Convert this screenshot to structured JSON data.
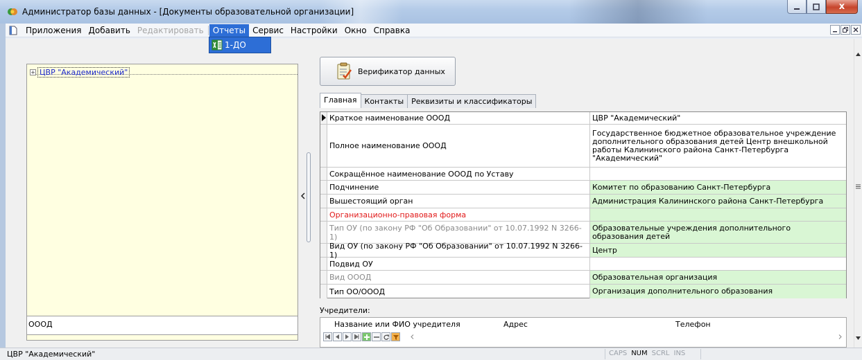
{
  "window": {
    "title": "Администратор базы данных - [Документы образовательной организации]",
    "close_glyph": "x"
  },
  "menu": {
    "items": [
      {
        "label": "Приложения",
        "state": "normal"
      },
      {
        "label": "Добавить",
        "state": "normal"
      },
      {
        "label": "Редактировать",
        "state": "disabled"
      },
      {
        "label": "Отчеты",
        "state": "active"
      },
      {
        "label": "Сервис",
        "state": "normal"
      },
      {
        "label": "Настройки",
        "state": "normal"
      },
      {
        "label": "Окно",
        "state": "normal"
      },
      {
        "label": "Справка",
        "state": "normal"
      }
    ],
    "dropdown_item": "1-ДО"
  },
  "tree": {
    "expander": "+",
    "root_label": "ЦВР \"Академический\"",
    "footer": "ОООД"
  },
  "toolbar": {
    "verify_label": "Верификатор данных"
  },
  "tabs": [
    "Главная",
    "Контакты",
    "Реквизиты и классификаторы"
  ],
  "grid": {
    "rows": [
      {
        "name": "Краткое наименование ОООД",
        "value": "ЦВР \"Академический\"",
        "style": "normal",
        "green": false,
        "current": true
      },
      {
        "name": "Полное наименование ОООД",
        "value": "Государственное бюджетное образовательное учреждение дополнительного образования детей Центр внешкольной работы Калининского района Санкт-Петербурга \"Академический\"",
        "style": "normal",
        "green": false,
        "current": false
      },
      {
        "name": "Сокращённое наименование ОООД по Уставу",
        "value": "",
        "style": "normal",
        "green": false,
        "current": false
      },
      {
        "name": "Подчинение",
        "value": "Комитет по образованию Санкт-Петербурга",
        "style": "normal",
        "green": true,
        "current": false
      },
      {
        "name": "Вышестоящий орган",
        "value": "Администрация Калининского района Санкт-Петербурга",
        "style": "normal",
        "green": true,
        "current": false
      },
      {
        "name": "Организационно-правовая форма",
        "value": "",
        "style": "red",
        "green": true,
        "current": false
      },
      {
        "name": "Тип ОУ (по закону  РФ \"Об Образовании\" от 10.07.1992 N 3266-1)",
        "value": "Образовательные учреждения  дополнительного образования детей",
        "style": "gray",
        "green": true,
        "current": false
      },
      {
        "name": "Вид ОУ (по закону  РФ \"Об Образовании\" от 10.07.1992 N 3266-1)",
        "value": "Центр",
        "style": "normal",
        "green": true,
        "current": false
      },
      {
        "name": "Подвид ОУ",
        "value": "",
        "style": "normal",
        "green": false,
        "current": false
      },
      {
        "name": "Вид ОООД",
        "value": "Образовательная организация",
        "style": "gray",
        "green": true,
        "current": false
      },
      {
        "name": "Тип ОО/ОООД",
        "value": "Организация дополнительного образования",
        "style": "normal",
        "green": true,
        "current": false
      }
    ]
  },
  "founders": {
    "label": "Учредители:",
    "columns": [
      "Название или ФИО учредителя",
      "Адрес",
      "Телефон"
    ]
  },
  "status": {
    "text": "ЦВР \"Академический\"",
    "keys": [
      {
        "label": "CAPS",
        "on": false
      },
      {
        "label": "NUM",
        "on": true
      },
      {
        "label": "SCRL",
        "on": false
      },
      {
        "label": "INS",
        "on": false
      }
    ]
  },
  "colors": {
    "accent": "#2d6ed6",
    "tree_bg": "#ffffe1",
    "green_cell": "#d9f6d4",
    "required_red": "#e11919"
  }
}
